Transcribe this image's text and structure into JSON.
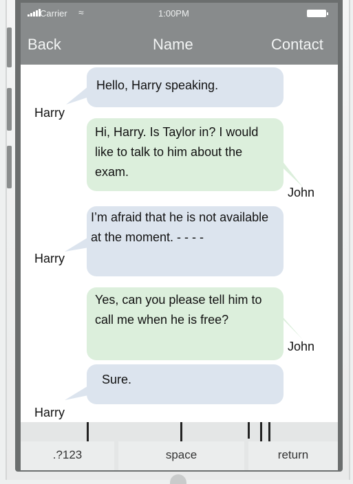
{
  "status_bar": {
    "carrier": "Carrier",
    "time": "1:00PM"
  },
  "nav": {
    "back": "Back",
    "title": "Name",
    "contact": "Contact"
  },
  "messages": [
    {
      "sender": "Harry",
      "text": "Hello, Harry speaking.",
      "color": "#dce4ee"
    },
    {
      "sender": "John",
      "text": "Hi, Harry. Is Taylor in? I would like to talk to him about the exam.",
      "color": "#dcefdc"
    },
    {
      "sender": "Harry",
      "text": "I’m afraid that he is not available at the moment. - - - -",
      "color": "#dce4ee"
    },
    {
      "sender": "John",
      "text": "Yes, can you please tell him to call me when he is free?",
      "color": "#dcefdc"
    },
    {
      "sender": "Harry",
      "text": "Sure.",
      "color": "#dce4ee"
    }
  ],
  "keyboard": {
    "numbers": ".?123",
    "space": "space",
    "return": "return"
  },
  "colors": {
    "bar": "#888b8c",
    "incoming": "#dce4ee",
    "outgoing": "#dcefdc"
  }
}
